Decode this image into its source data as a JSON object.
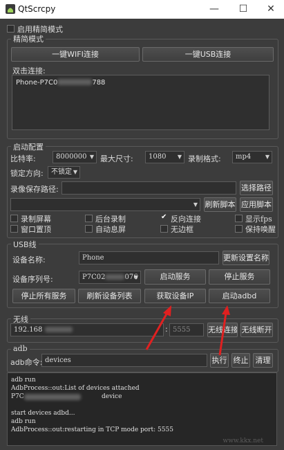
{
  "window": {
    "title": "QtScrcpy",
    "min": "—",
    "max": "☐",
    "close": "✕"
  },
  "simple_mode": {
    "label": "启用精简模式",
    "checked": false
  },
  "simple_group": {
    "title": "精简模式",
    "wifi_btn": "一键WIFI连接",
    "usb_btn": "一键USB连接",
    "double_click_label": "双击连接:",
    "device_prefix": "Phone-P7C0",
    "device_suffix": "788"
  },
  "start_config": {
    "title": "启动配置",
    "bitrate_label": "比特率:",
    "bitrate_value": "8000000",
    "maxsize_label": "最大尺寸:",
    "maxsize_value": "1080",
    "record_format_label": "录制格式:",
    "record_format_value": "mp4",
    "lock_dir_label": "锁定方向:",
    "lock_dir_value": "不锁定",
    "record_path_label": "录像保存路径:",
    "record_path_value": "",
    "select_path_btn": "选择路径",
    "script_value": "",
    "refresh_script_btn": "刷新脚本",
    "apply_script_btn": "应用脚本",
    "options": [
      {
        "label": "录制屏幕",
        "checked": false
      },
      {
        "label": "后台录制",
        "checked": false
      },
      {
        "label": "反向连接",
        "checked": true
      },
      {
        "label": "显示fps",
        "checked": false
      },
      {
        "label": "窗口置顶",
        "checked": false
      },
      {
        "label": "自动息屏",
        "checked": false
      },
      {
        "label": "无边框",
        "checked": false
      },
      {
        "label": "保持唤醒",
        "checked": false
      }
    ]
  },
  "usb": {
    "title": "USB线",
    "device_name_label": "设备名称:",
    "device_name_value": "Phone",
    "update_name_btn": "更新设置名称",
    "serial_label": "设备序列号:",
    "serial_prefix": "P7C02",
    "serial_suffix": "076",
    "start_service_btn": "启动服务",
    "stop_service_btn": "停止服务",
    "stop_all_btn": "停止所有服务",
    "refresh_list_btn": "刷新设备列表",
    "get_ip_btn": "获取设备IP",
    "start_adbd_btn": "启动adbd"
  },
  "wireless": {
    "title": "无线",
    "ip_value": "192.168",
    "port_value": "5555",
    "connect_btn": "无线连接",
    "disconnect_btn": "无线断开"
  },
  "adb": {
    "title": "adb",
    "cmd_label": "adb命令:",
    "cmd_value": "devices",
    "run_btn": "执行",
    "stop_btn": "终止",
    "clear_btn": "清理"
  },
  "console": {
    "lines": [
      "adb run",
      "AdbProcess::out:List of devices attached",
      "P7C",
      "device",
      "",
      "start devices adbd...",
      "adb run",
      "AdbProcess::out:restarting in TCP mode port: 5555"
    ]
  },
  "watermark": "www.kkx.net",
  "colors": {
    "background": "#3c3c3c",
    "arrow": "#e02020",
    "titlebar": "#ffffff"
  }
}
